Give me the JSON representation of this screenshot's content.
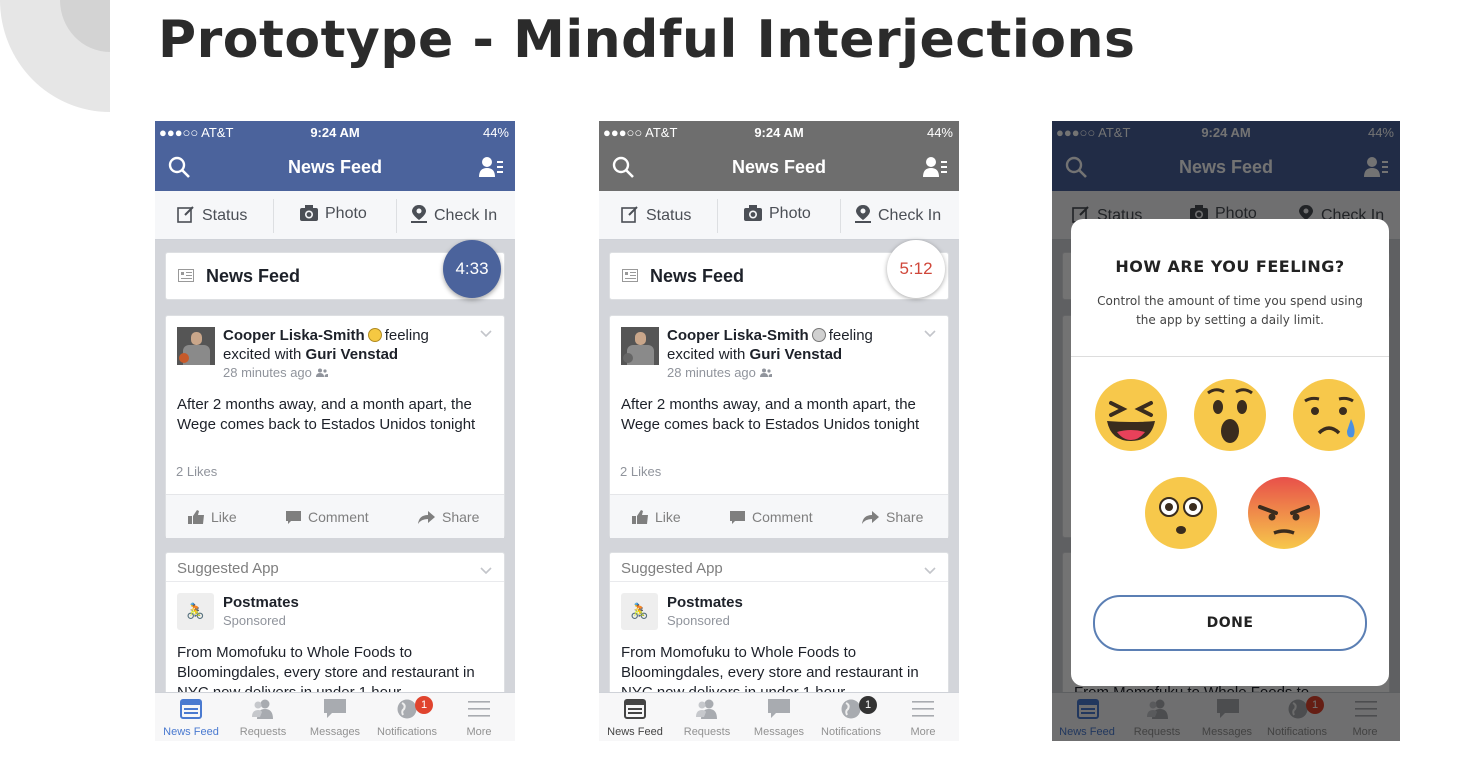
{
  "title": "Prototype - Mindful Interjections",
  "colors": {
    "fb_blue": "#4b639c",
    "grey_nav": "#6e6e6e",
    "dark_blue": "#3d5382",
    "accent_blue": "#5b7fb4",
    "badge_red": "#e0442e",
    "timer_red": "#d0473a"
  },
  "status_bar": {
    "carrier": "●●●○○ AT&T",
    "time": "9:24 AM",
    "battery": "44%"
  },
  "nav": {
    "title": "News Feed"
  },
  "actions": {
    "status": "Status",
    "photo": "Photo",
    "checkin": "Check In"
  },
  "news_feed_label": "News Feed",
  "timers": {
    "phone1": "4:33",
    "phone2": "5:12"
  },
  "post": {
    "author": "Cooper Liska-Smith",
    "feeling_text": "feeling",
    "excited_with": "excited with",
    "tagged": "Guri Venstad",
    "time": "28 minutes ago",
    "text": "After 2 months away, and a month apart, the Wege comes back to Estados Unidos tonight",
    "likes": "2 Likes",
    "like": "Like",
    "comment": "Comment",
    "share": "Share"
  },
  "suggested": {
    "header": "Suggested App",
    "app_name": "Postmates",
    "sponsored": "Sponsored",
    "text": "From Momofuku to Whole Foods to Bloomingdales, every store and restaurant in NYC now delivers in under 1 hour"
  },
  "tabs": {
    "news_feed": "News Feed",
    "requests": "Requests",
    "messages": "Messages",
    "notifications": "Notifications",
    "more": "More"
  },
  "notification_badge": "1",
  "modal": {
    "title": "HOW ARE YOU FEELING?",
    "subtitle": "Control the amount of time you spend using the app by setting a daily limit.",
    "faces": [
      "laughing-face-icon",
      "surprised-face-icon",
      "sad-face-icon",
      "wide-eyed-face-icon",
      "angry-face-icon"
    ],
    "done": "DONE"
  }
}
